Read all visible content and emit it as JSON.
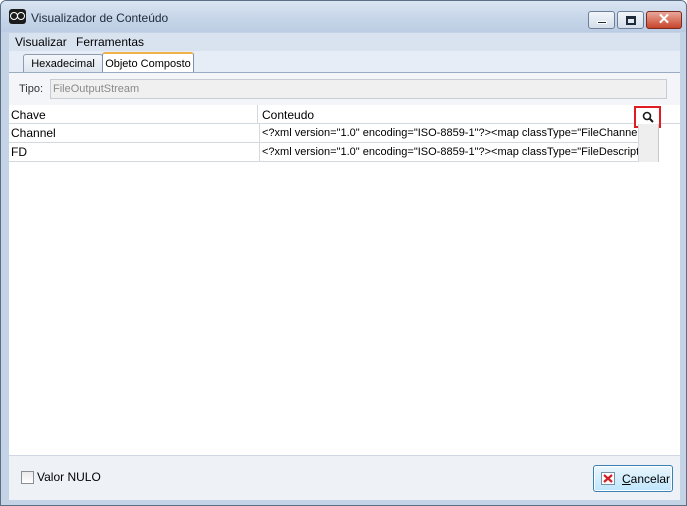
{
  "window": {
    "title": "Visualizador de Conteúdo",
    "close_glyph": "✕"
  },
  "menu": {
    "visualizar": "Visualizar",
    "ferramentas": "Ferramentas"
  },
  "tabs": [
    {
      "label": "Hexadecimal",
      "active": false
    },
    {
      "label": "Objeto Composto",
      "active": true
    }
  ],
  "tipo": {
    "label": "Tipo:",
    "value": "FileOutputStream"
  },
  "grid": {
    "columns": [
      "Chave",
      "Conteudo"
    ],
    "rows": [
      {
        "key": "Channel",
        "value": "<?xml version=\"1.0\" encoding=\"ISO-8859-1\"?><map classType=\"FileChannelImpl\">"
      },
      {
        "key": "FD",
        "value": "<?xml version=\"1.0\" encoding=\"ISO-8859-1\"?><map classType=\"FileDescriptor\">"
      }
    ],
    "search_icon": "magnifier-icon"
  },
  "footer": {
    "null_checkbox_label": "Valor NULO",
    "null_checked": false,
    "cancel_label_first": "C",
    "cancel_label_rest": "ancelar"
  },
  "colors": {
    "highlight": "#e11b22",
    "active_tab_accent": "#f0b24a"
  }
}
